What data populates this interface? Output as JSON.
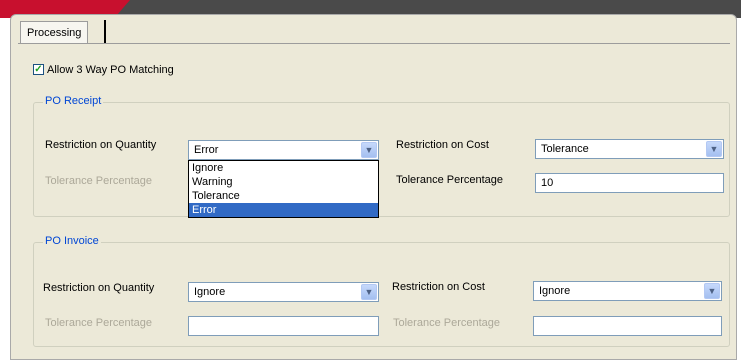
{
  "tabs": [
    {
      "label": "Processing"
    }
  ],
  "allow_3way": {
    "label": "Allow 3 Way PO Matching",
    "checked": true,
    "mark": "✓"
  },
  "po_receipt": {
    "title": "PO Receipt",
    "qty_label": "Restriction on Quantity",
    "qty_value": "Error",
    "qty_options": [
      "Ignore",
      "Warning",
      "Tolerance",
      "Error"
    ],
    "qty_selected_index": 3,
    "tol_label_left": "Tolerance Percentage",
    "cost_label": "Restriction on Cost",
    "cost_value": "Tolerance",
    "tol_label_right": "Tolerance Percentage",
    "tol_value_right": "10"
  },
  "po_invoice": {
    "title": "PO Invoice",
    "qty_label": "Restriction on Quantity",
    "qty_value": "Ignore",
    "tol_label_left": "Tolerance Percentage",
    "tol_value_left": "",
    "cost_label": "Restriction on Cost",
    "cost_value": "Ignore",
    "tol_label_right": "Tolerance Percentage",
    "tol_value_right": ""
  },
  "icons": {
    "dropdown_arrow": "▼"
  },
  "colors": {
    "group_title": "#0046d5",
    "selection": "#316ac5",
    "panel_bg": "#ece9d8",
    "accent": "#c8102e",
    "header_bar": "#4a4a4a"
  }
}
